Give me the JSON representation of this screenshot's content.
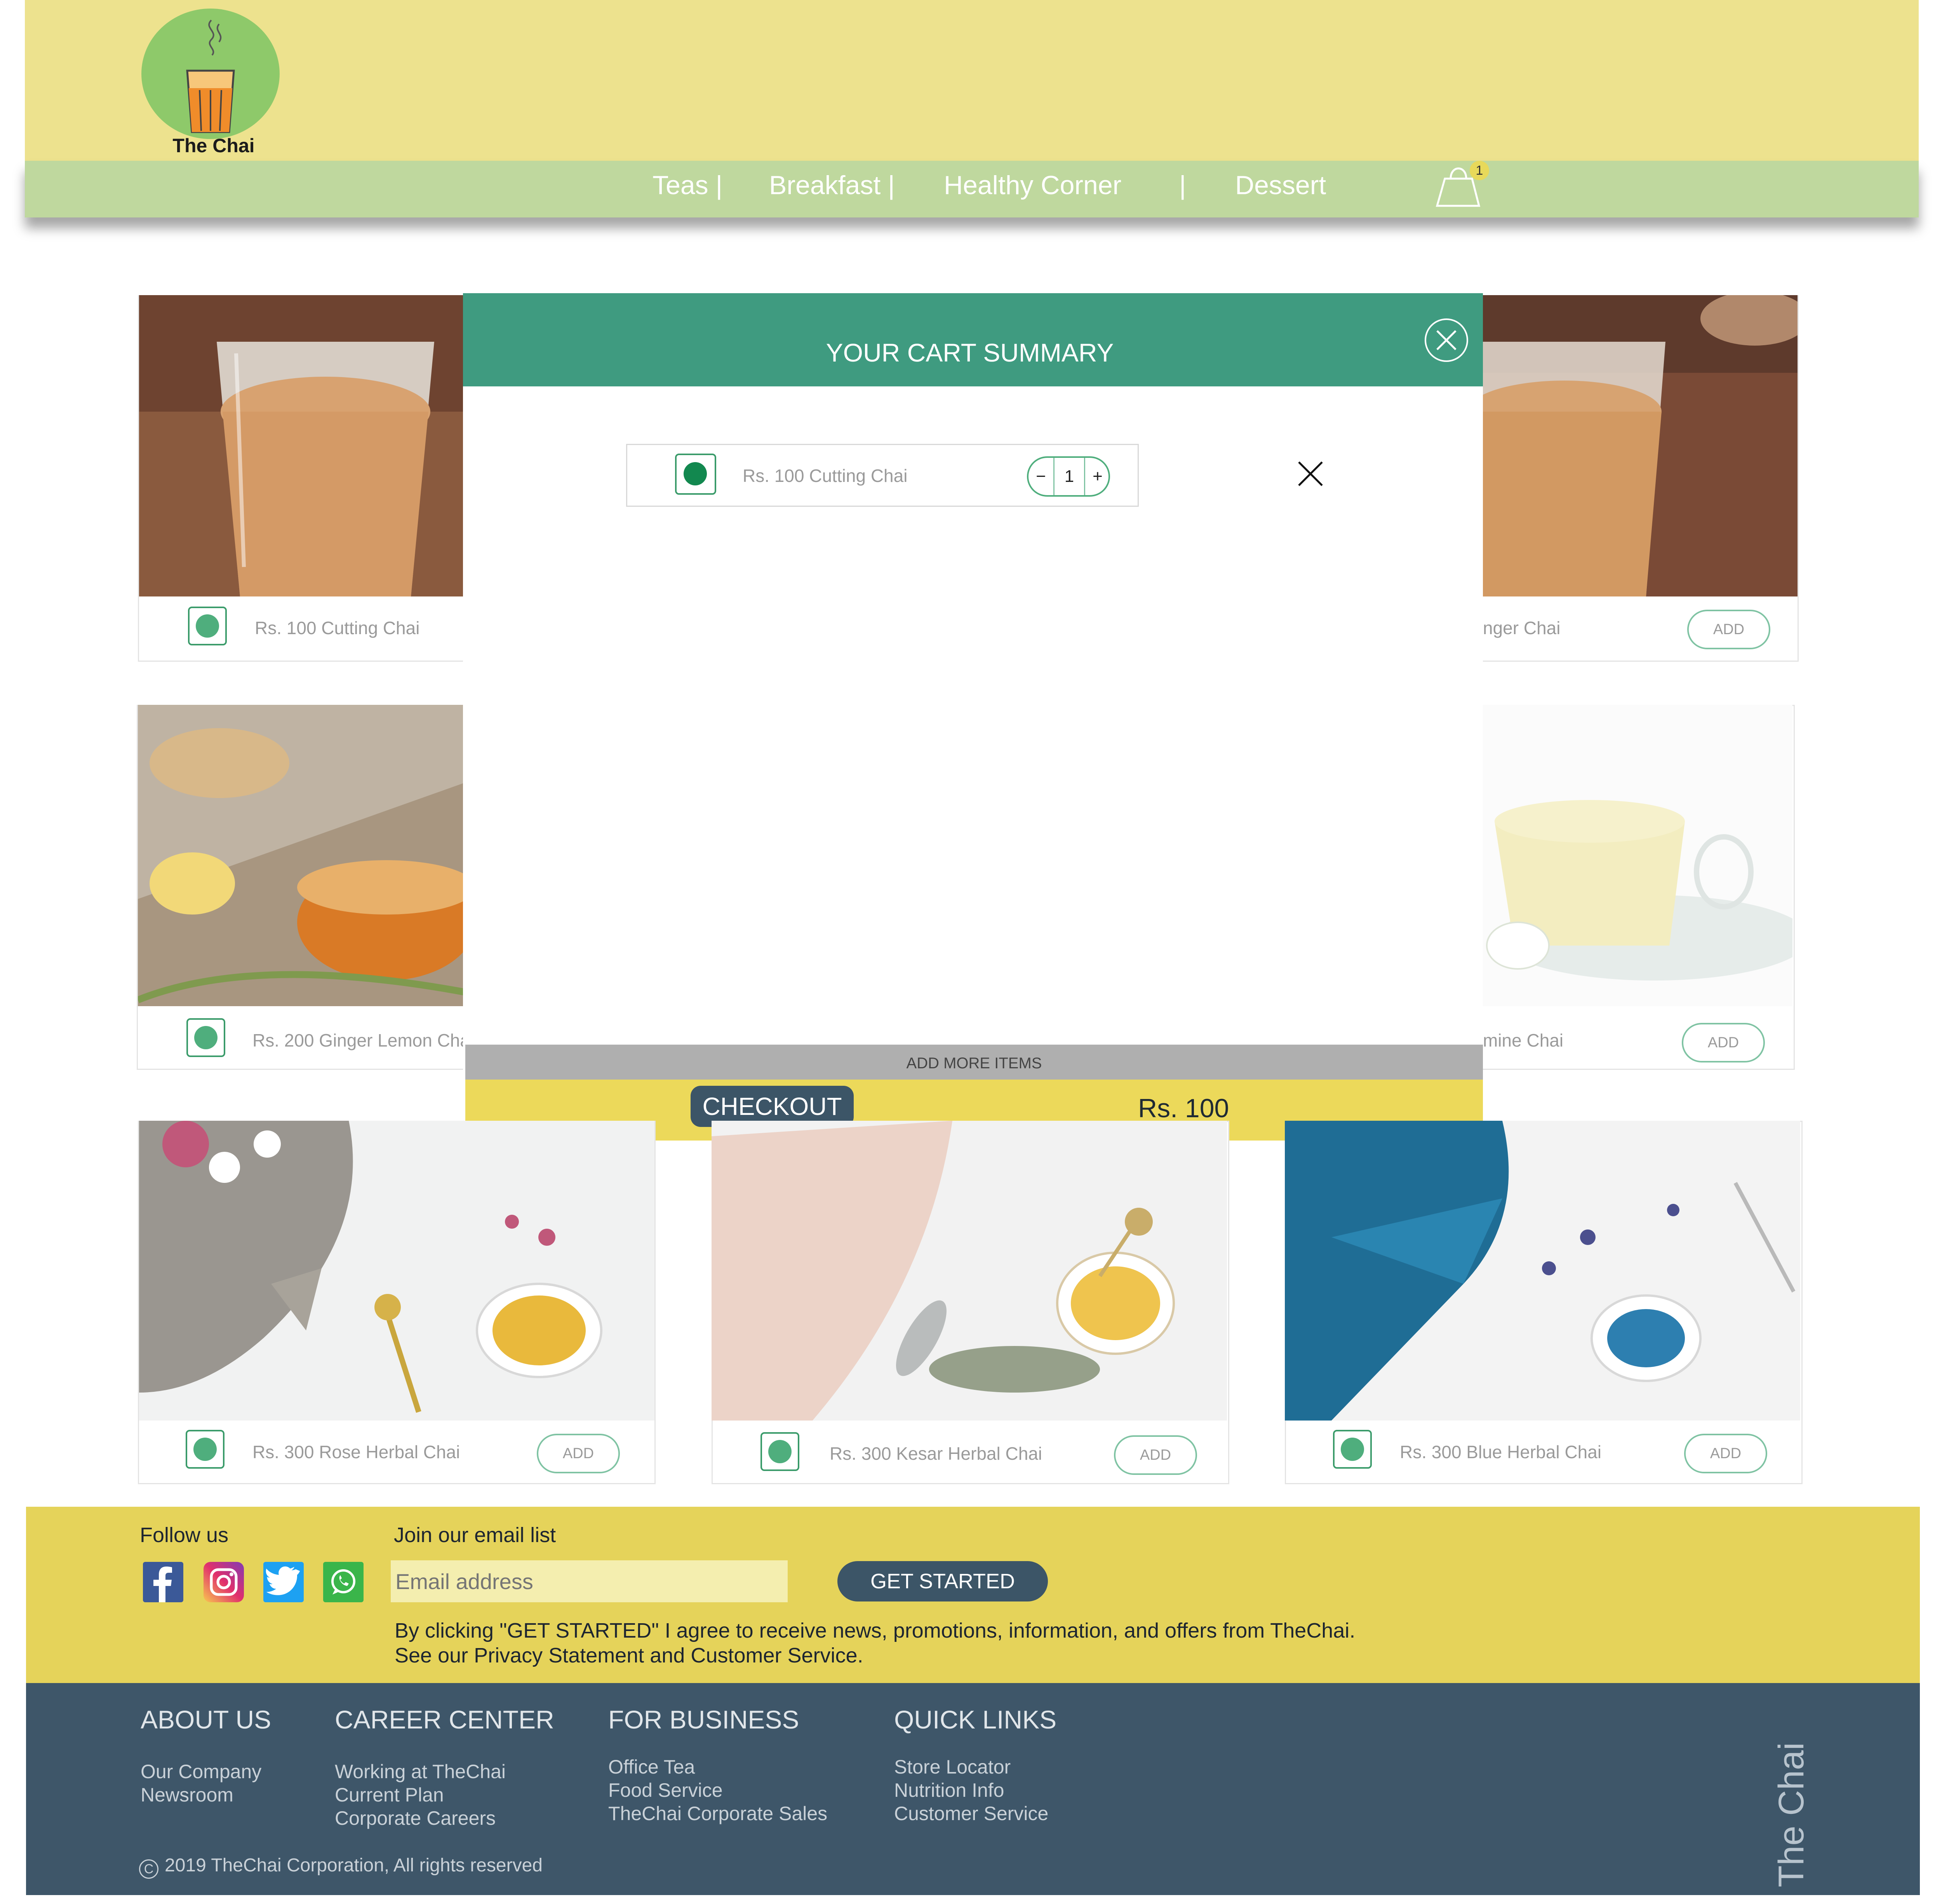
{
  "brand": {
    "logo_text": "The Chai"
  },
  "nav": {
    "items": [
      "Teas |",
      "Breakfast |",
      "Healthy Corner",
      "|",
      "Dessert"
    ],
    "cart_count": "1"
  },
  "products": [
    {
      "label": "Rs. 100 Cutting Chai",
      "add": "ADD"
    },
    {
      "label": "nger Chai",
      "add": "ADD"
    },
    {
      "label": "Rs. 200 Ginger Lemon Cha",
      "add": "ADD"
    },
    {
      "label": "mine Chai",
      "add": "ADD"
    },
    {
      "label": "Rs. 300 Rose Herbal Chai",
      "add": "ADD"
    },
    {
      "label": "Rs. 300 Kesar Herbal Chai",
      "add": "ADD"
    },
    {
      "label": "Rs. 300 Blue Herbal Chai",
      "add": "ADD"
    }
  ],
  "cart_modal": {
    "title": "YOUR CART SUMMARY",
    "item": {
      "label": "Rs. 100 Cutting Chai",
      "minus": "−",
      "qty": "1",
      "plus": "+"
    },
    "add_more": "ADD MORE ITEMS",
    "checkout": "CHECKOUT",
    "total": "Rs. 100"
  },
  "footer": {
    "follow_us": "Follow us",
    "join_email": "Join our email list",
    "email_placeholder": "Email address",
    "get_started": "GET STARTED",
    "disclaimer_1": "By clicking \"GET STARTED\" I agree to receive news, promotions, information, and offers from TheChai.",
    "disclaimer_2": "See our Privacy Statement and Customer Service.",
    "columns": [
      {
        "heading": "ABOUT US",
        "links": [
          "Our Company",
          "Newsroom"
        ]
      },
      {
        "heading": "CAREER CENTER",
        "links": [
          "Working at TheChai",
          "Current Plan",
          "Corporate Careers"
        ]
      },
      {
        "heading": "FOR BUSINESS",
        "links": [
          "Office Tea",
          "Food Service",
          "TheChai Corporate Sales"
        ]
      },
      {
        "heading": "QUICK LINKS",
        "links": [
          "Store Locator",
          "Nutrition Info",
          "Customer Service"
        ]
      }
    ],
    "copyright": "2019 TheChai Corporation, All rights reserved",
    "vertical_brand": "The Chai"
  },
  "colors": {
    "header": "#ede28e",
    "nav": "#bfd89e",
    "modal_header": "#3f9b80",
    "checkout_bar": "#ecd95a",
    "footer_yellow": "#e5d35a",
    "footer_dark": "#3e5669"
  },
  "icons": [
    "tea-glass-logo-icon",
    "shopping-bag-icon",
    "close-circle-icon",
    "close-x-icon",
    "veg-indicator-icon",
    "facebook-icon",
    "instagram-icon",
    "twitter-icon",
    "whatsapp-icon",
    "copyright-icon"
  ]
}
